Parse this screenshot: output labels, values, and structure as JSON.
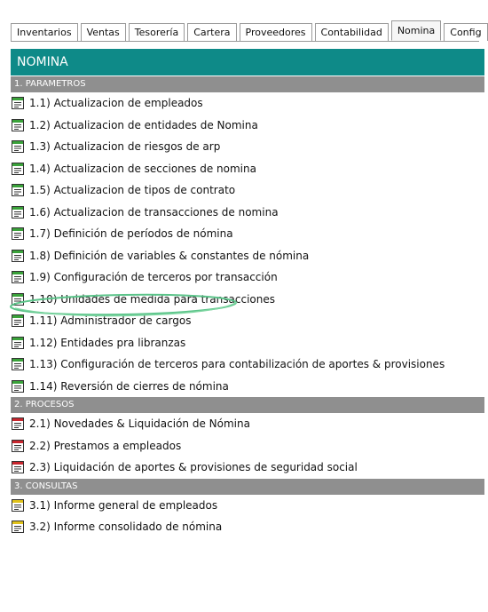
{
  "tabs": [
    {
      "label": "Inventarios",
      "active": false
    },
    {
      "label": "Ventas",
      "active": false
    },
    {
      "label": "Tesorería",
      "active": false
    },
    {
      "label": "Cartera",
      "active": false
    },
    {
      "label": "Proveedores",
      "active": false
    },
    {
      "label": "Contabilidad",
      "active": false
    },
    {
      "label": "Nomina",
      "active": true
    },
    {
      "label": "Config",
      "active": false
    }
  ],
  "header": {
    "title": "NOMINA"
  },
  "colors": {
    "header": "#0e8a88",
    "section": "#8f8f8f",
    "icon_green": "#3aa23a",
    "icon_red": "#c8262e",
    "icon_yellow": "#e0c21a"
  },
  "sections": [
    {
      "title": "1. PARAMETROS",
      "icon_color": "green",
      "items": [
        "1.1) Actualizacion de empleados",
        "1.2) Actualizacion de entidades de Nomina",
        "1.3) Actualizacion de riesgos de arp",
        "1.4) Actualizacion de secciones de nomina",
        "1.5) Actualizacion de tipos de contrato",
        "1.6) Actualizacion de transacciones de nomina",
        "1.7) Definición de períodos de nómina",
        "1.8) Definición de variables & constantes de nómina",
        "1.9) Configuración de terceros por transacción",
        "1.10) Unidades de medida para transacciones",
        "1.11) Administrador de cargos",
        "1.12) Entidades pra libranzas",
        "1.13) Configuración de terceros para contabilización de aportes & provisiones",
        "1.14) Reversión de cierres de nómina"
      ]
    },
    {
      "title": "2. PROCESOS",
      "icon_color": "red",
      "items": [
        "2.1) Novedades & Liquidación de Nómina",
        "2.2) Prestamos a empleados",
        "2.3) Liquidación de aportes & provisiones de seguridad social"
      ]
    },
    {
      "title": "3. CONSULTAS",
      "icon_color": "yellow",
      "items": [
        "3.1) Informe general de empleados",
        "3.2) Informe consolidado de nómina"
      ]
    }
  ]
}
